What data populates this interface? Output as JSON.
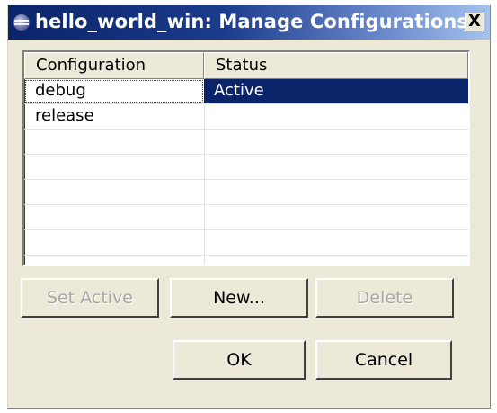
{
  "window": {
    "title": "hello_world_win: Manage Configurations",
    "close_label": "X"
  },
  "table": {
    "columns": [
      "Configuration",
      "Status"
    ],
    "rows": [
      {
        "configuration": "debug",
        "status": "Active",
        "selected": true
      },
      {
        "configuration": "release",
        "status": "",
        "selected": false
      }
    ]
  },
  "buttons": {
    "set_active": "Set Active",
    "new": "New...",
    "delete": "Delete",
    "ok": "OK",
    "cancel": "Cancel"
  },
  "colors": {
    "selection": "#0a246a",
    "dialog_face": "#ece9d8",
    "disabled_text": "#a7a6a0"
  },
  "icons": {
    "app": "eclipse-icon",
    "close": "close-icon"
  }
}
